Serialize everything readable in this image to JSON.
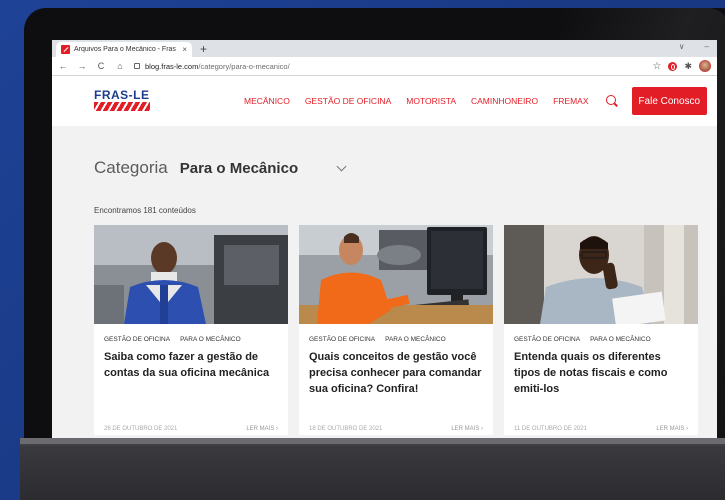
{
  "browser": {
    "tab_title": "Arquivos Para o Mecânico - Fras",
    "tab_close": "×",
    "new_tab": "+",
    "win_min": "∨",
    "win_max": "–",
    "back": "←",
    "forward": "→",
    "reload": "C",
    "home": "⌂",
    "url_domain": "blog.fras-le.com",
    "url_path": "/category/para-o-mecanico/",
    "star": "☆",
    "puzzle": "✱"
  },
  "site": {
    "logo": "FRAS-LE",
    "nav": [
      "MECÂNICO",
      "GESTÃO DE OFICINA",
      "MOTORISTA",
      "CAMINHONEIRO",
      "FREMAX"
    ],
    "cta": "Fale Conosco"
  },
  "category": {
    "label": "Categoria",
    "value": "Para o Mecânico"
  },
  "results_count": "Encontramos 181 conteúdos",
  "cards": [
    {
      "tags": [
        "GESTÃO DE OFICINA",
        "PARA O MECÂNICO"
      ],
      "title": "Saiba como fazer a gestão de contas da sua oficina mecânica",
      "date": "26 DE OUTUBRO DE 2021",
      "read_more": "LER MAIS  ›"
    },
    {
      "tags": [
        "GESTÃO DE OFICINA",
        "PARA O MECÂNICO"
      ],
      "title": "Quais conceitos de gestão você precisa conhecer para comandar sua oficina? Confira!",
      "date": "18 DE OUTUBRO DE 2021",
      "read_more": "LER MAIS  ›"
    },
    {
      "tags": [
        "GESTÃO DE OFICINA",
        "PARA O MECÂNICO"
      ],
      "title": "Entenda quais os diferentes tipos de notas fiscais e como emiti-los",
      "date": "11 DE OUTUBRO DE 2021",
      "read_more": "LER MAIS  ›"
    }
  ],
  "colors": {
    "brand_red": "#e31d26",
    "brand_blue": "#1c3c8c",
    "background_blue": "#1b3c8c"
  }
}
